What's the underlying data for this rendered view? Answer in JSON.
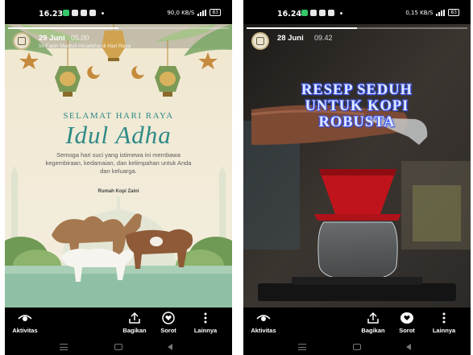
{
  "left": {
    "status": {
      "time": "16.23",
      "speed": "90,0 KB/S",
      "battery": "83"
    },
    "story": {
      "date": "29 Juni",
      "time": "05.00",
      "subtitle": "Ini Fakih Madtull Hizaddha di Hari Raya",
      "progress": 0.5
    },
    "card": {
      "line1": "SELAMAT HARI RAYA",
      "line2": "Idul Adha",
      "message": "Semoga hari suci yang istimewa ini membawa kegembiraan, kedamaian, dan kelimpahan untuk Anda dan keluarga.",
      "signature": "Rumah Kopi Zaini"
    },
    "actions": {
      "activity": "Aktivitas",
      "share": "Bagikan",
      "highlight": "Sorot",
      "more": "Lainnya"
    }
  },
  "right": {
    "status": {
      "time": "16.24",
      "speed": "0,15 KB/S",
      "battery": "83"
    },
    "story": {
      "date": "28 Juni",
      "time": "09.42",
      "progress": 0.5
    },
    "overlay": {
      "line1": "RESEP SEDUH",
      "line2": "UNTUK KOPI",
      "line3": "ROBUSTA"
    },
    "actions": {
      "activity": "Aktivitas",
      "share": "Bagikan",
      "highlight": "Sorot",
      "more": "Lainnya"
    }
  },
  "icons": {
    "activity": "eye-icon",
    "share": "share-icon",
    "highlight": "heart-circle-icon",
    "more": "more-vertical-icon"
  },
  "colors": {
    "accent_teal": "#2f8a88",
    "highlight_blue": "#3440d8",
    "dripper_red": "#c0141c"
  }
}
